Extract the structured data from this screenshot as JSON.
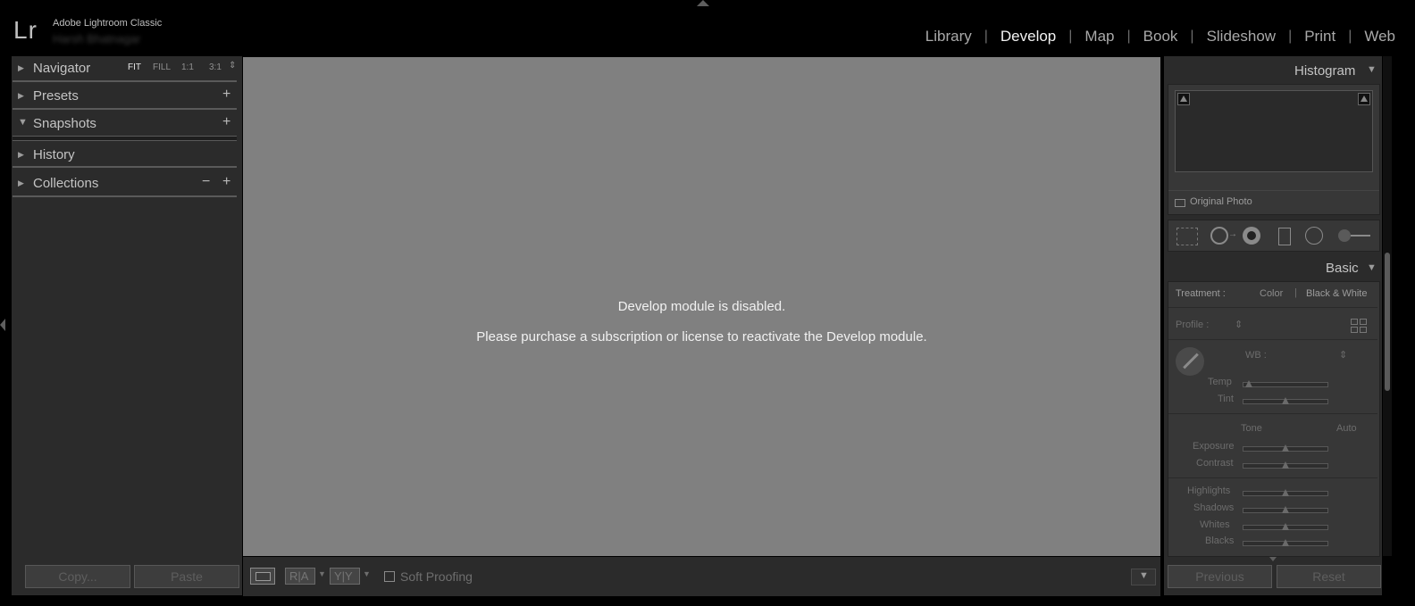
{
  "app": {
    "logo": "Lr",
    "name": "Adobe Lightroom Classic",
    "user": "Harsh Bhatnagar"
  },
  "modules": [
    "Library",
    "Develop",
    "Map",
    "Book",
    "Slideshow",
    "Print",
    "Web"
  ],
  "active_module": "Develop",
  "left_panel": {
    "navigator": {
      "label": "Navigator",
      "options": [
        "FIT",
        "FILL",
        "1:1",
        "3:1"
      ],
      "selected": "FIT"
    },
    "presets": "Presets",
    "snapshots": "Snapshots",
    "history": "History",
    "collections": "Collections",
    "plus": "+",
    "minus": "−",
    "copy_button": "Copy...",
    "paste_button": "Paste"
  },
  "center": {
    "message_title": "Develop module is disabled.",
    "message_body": "Please purchase a subscription or license to reactivate the Develop module."
  },
  "toolbar": {
    "ra": "R|A",
    "yy": "Y|Y",
    "soft_proofing": "Soft Proofing"
  },
  "right_panel": {
    "histogram": "Histogram",
    "original_photo": "Original Photo",
    "basic": "Basic",
    "treatment_label": "Treatment :",
    "treatment_color": "Color",
    "treatment_bw": "Black & White",
    "profile_label": "Profile :",
    "wb_label": "WB :",
    "temp": "Temp",
    "tint": "Tint",
    "tone": "Tone",
    "auto": "Auto",
    "exposure": "Exposure",
    "contrast": "Contrast",
    "highlights": "Highlights",
    "shadows": "Shadows",
    "whites": "Whites",
    "blacks": "Blacks",
    "previous_button": "Previous",
    "reset_button": "Reset"
  },
  "colors": {
    "background": "#000000",
    "panel": "#2b2b2b",
    "canvas": "#808080",
    "text_active": "#f2f2f2",
    "text_inactive": "#a9a9a9"
  }
}
